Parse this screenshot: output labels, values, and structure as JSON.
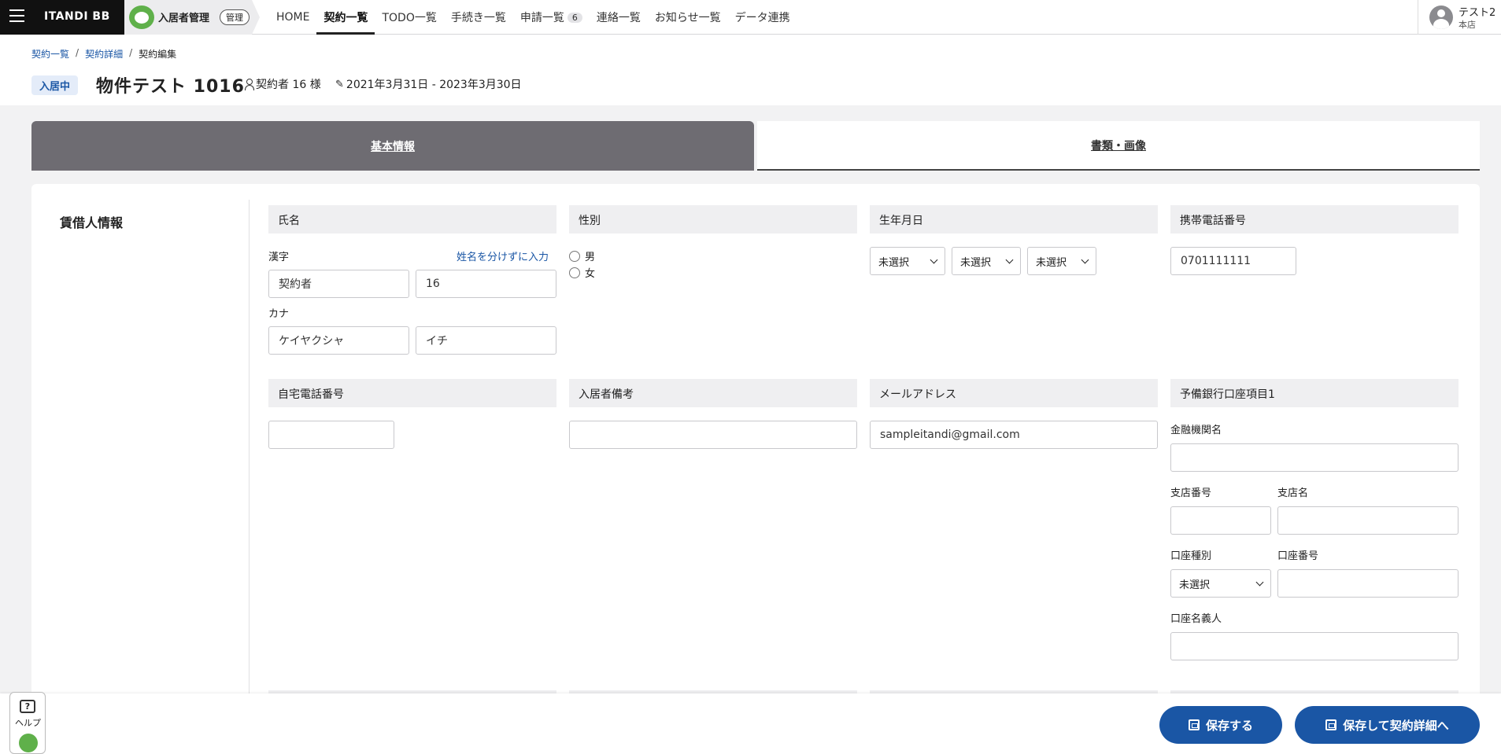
{
  "header": {
    "brand": "ITANDI BB",
    "app_name": "入居者管理",
    "app_tag": "管理",
    "nav": [
      {
        "label": "HOME"
      },
      {
        "label": "契約一覧"
      },
      {
        "label": "TODO一覧"
      },
      {
        "label": "手続き一覧"
      },
      {
        "label": "申請一覧",
        "badge": "6"
      },
      {
        "label": "連絡一覧"
      },
      {
        "label": "お知らせ一覧"
      },
      {
        "label": "データ連携"
      }
    ],
    "user_name": "テスト2",
    "user_branch": "本店"
  },
  "breadcrumb": {
    "items": [
      "契約一覧",
      "契約詳細",
      "契約編集"
    ],
    "separator": "/"
  },
  "contract": {
    "status": "入居中",
    "property_name": "物件テスト 1016",
    "contractor": "契約者 16 様",
    "period": "2021年3月31日 - 2023年3月30日"
  },
  "tabs": [
    "基本情報",
    "書類・画像"
  ],
  "section": {
    "title": "賃借人情報",
    "name": {
      "label": "氏名",
      "kanji_label": "漢字",
      "split_link": "姓名を分けずに入力",
      "kanji_last": "契約者",
      "kanji_first": "16",
      "kana_label": "カナ",
      "kana_last": "ケイヤクシャ",
      "kana_first": "イチ"
    },
    "gender": {
      "label": "性別",
      "options": [
        "男",
        "女"
      ]
    },
    "birthdate": {
      "label": "生年月日",
      "year": "未選択",
      "month": "未選択",
      "day": "未選択"
    },
    "mobile": {
      "label": "携帯電話番号",
      "value": "0701111111"
    },
    "home_phone": {
      "label": "自宅電話番号",
      "value": ""
    },
    "remarks": {
      "label": "入居者備考",
      "value": ""
    },
    "email": {
      "label": "メールアドレス",
      "value": "sampleitandi@gmail.com"
    },
    "bank": {
      "label": "予備銀行口座項目1",
      "institution_label": "金融機関名",
      "branch_no_label": "支店番号",
      "branch_name_label": "支店名",
      "account_type_label": "口座種別",
      "account_type_value": "未選択",
      "account_no_label": "口座番号",
      "holder_label": "口座名義人"
    }
  },
  "footer": {
    "help_label": "ヘルプ",
    "help_icon_text": "?",
    "save_label": "保存する",
    "save_detail_label": "保存して契約詳細へ"
  }
}
